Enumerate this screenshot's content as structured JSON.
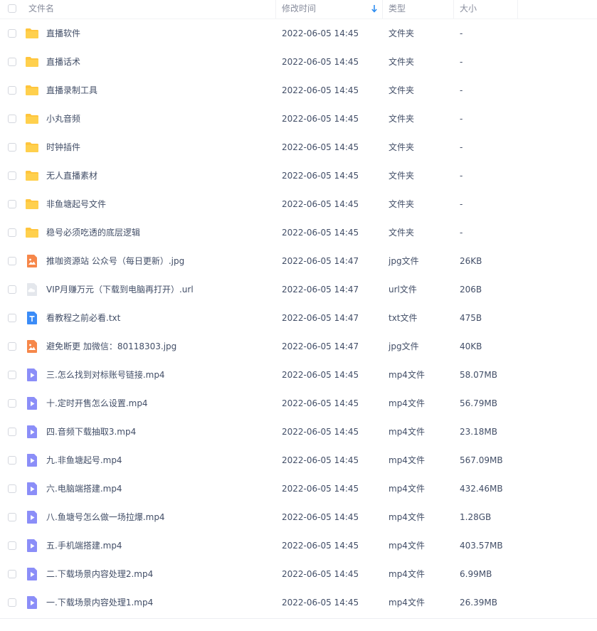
{
  "header": {
    "name_label": "文件名",
    "time_label": "修改时间",
    "type_label": "类型",
    "size_label": "大小"
  },
  "colors": {
    "folder": "#ffc53d",
    "image": "#f6874a",
    "url": "#d9dde4",
    "txt": "#3b8cf7",
    "video": "#8b8ef8",
    "sort_arrow": "#2d8cf0"
  },
  "rows": [
    {
      "icon": "folder-icon",
      "name": "直播软件",
      "time": "2022-06-05 14:45",
      "type": "文件夹",
      "size": "-"
    },
    {
      "icon": "folder-icon",
      "name": "直播话术",
      "time": "2022-06-05 14:45",
      "type": "文件夹",
      "size": "-"
    },
    {
      "icon": "folder-icon",
      "name": "直播录制工具",
      "time": "2022-06-05 14:45",
      "type": "文件夹",
      "size": "-"
    },
    {
      "icon": "folder-icon",
      "name": "小丸音频",
      "time": "2022-06-05 14:45",
      "type": "文件夹",
      "size": "-"
    },
    {
      "icon": "folder-icon",
      "name": "时钟插件",
      "time": "2022-06-05 14:45",
      "type": "文件夹",
      "size": "-"
    },
    {
      "icon": "folder-icon",
      "name": "无人直播素材",
      "time": "2022-06-05 14:45",
      "type": "文件夹",
      "size": "-"
    },
    {
      "icon": "folder-icon",
      "name": "非鱼塘起号文件",
      "time": "2022-06-05 14:45",
      "type": "文件夹",
      "size": "-"
    },
    {
      "icon": "folder-icon",
      "name": "稳号必须吃透的底层逻辑",
      "time": "2022-06-05 14:45",
      "type": "文件夹",
      "size": "-"
    },
    {
      "icon": "image-file-icon",
      "name": "推咖资源站 公众号（每日更新）.jpg",
      "time": "2022-06-05 14:47",
      "type": "jpg文件",
      "size": "26KB"
    },
    {
      "icon": "url-file-icon",
      "name": "VIP月赚万元（下载到电脑再打开）.url",
      "time": "2022-06-05 14:47",
      "type": "url文件",
      "size": "206B"
    },
    {
      "icon": "txt-file-icon",
      "name": "看教程之前必看.txt",
      "time": "2022-06-05 14:47",
      "type": "txt文件",
      "size": "475B"
    },
    {
      "icon": "image-file-icon",
      "name": "避免断更 加微信：80118303.jpg",
      "time": "2022-06-05 14:47",
      "type": "jpg文件",
      "size": "40KB"
    },
    {
      "icon": "video-file-icon",
      "name": "三.怎么找到对标账号链接.mp4",
      "time": "2022-06-05 14:45",
      "type": "mp4文件",
      "size": "58.07MB"
    },
    {
      "icon": "video-file-icon",
      "name": "十.定时开售怎么设置.mp4",
      "time": "2022-06-05 14:45",
      "type": "mp4文件",
      "size": "56.79MB"
    },
    {
      "icon": "video-file-icon",
      "name": "四.音频下载抽取3.mp4",
      "time": "2022-06-05 14:45",
      "type": "mp4文件",
      "size": "23.18MB"
    },
    {
      "icon": "video-file-icon",
      "name": "九.非鱼塘起号.mp4",
      "time": "2022-06-05 14:45",
      "type": "mp4文件",
      "size": "567.09MB"
    },
    {
      "icon": "video-file-icon",
      "name": "六.电脑端搭建.mp4",
      "time": "2022-06-05 14:45",
      "type": "mp4文件",
      "size": "432.46MB"
    },
    {
      "icon": "video-file-icon",
      "name": "八.鱼塘号怎么做一场拉爆.mp4",
      "time": "2022-06-05 14:45",
      "type": "mp4文件",
      "size": "1.28GB"
    },
    {
      "icon": "video-file-icon",
      "name": "五.手机端搭建.mp4",
      "time": "2022-06-05 14:45",
      "type": "mp4文件",
      "size": "403.57MB"
    },
    {
      "icon": "video-file-icon",
      "name": "二.下载场景内容处理2.mp4",
      "time": "2022-06-05 14:45",
      "type": "mp4文件",
      "size": "6.99MB"
    },
    {
      "icon": "video-file-icon",
      "name": "一.下载场景内容处理1.mp4",
      "time": "2022-06-05 14:45",
      "type": "mp4文件",
      "size": "26.39MB"
    }
  ]
}
